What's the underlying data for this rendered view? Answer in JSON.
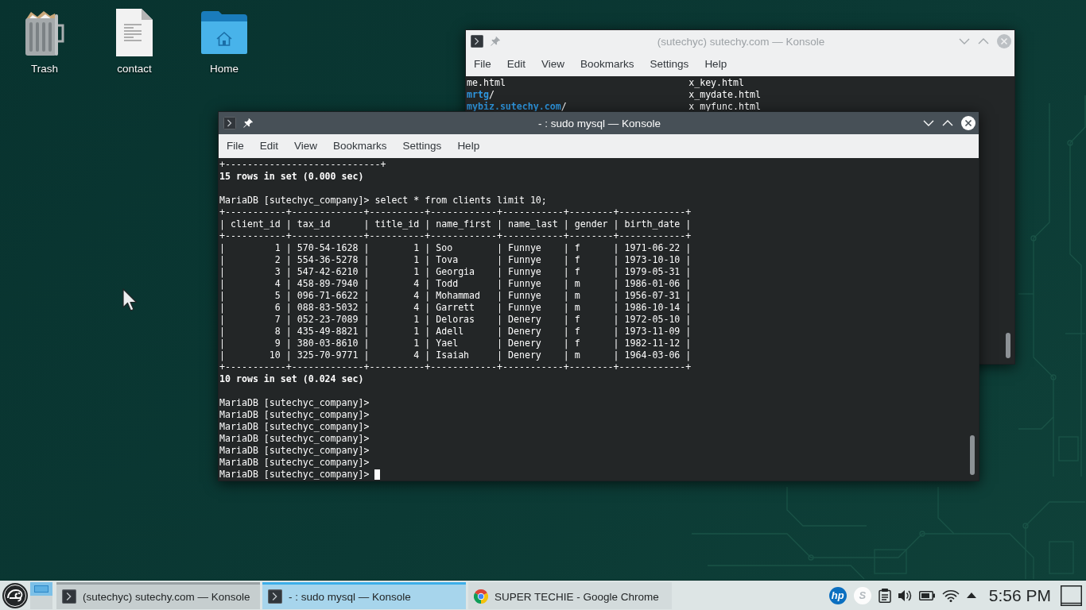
{
  "desktop_icons": [
    {
      "kind": "trash",
      "label": "Trash"
    },
    {
      "kind": "document",
      "label": "contact"
    },
    {
      "kind": "home_folder",
      "label": "Home"
    }
  ],
  "windows": [
    {
      "title": "(sutechyc) sutechy.com — Konsole",
      "active": false,
      "menu": [
        "File",
        "Edit",
        "View",
        "Bookmarks",
        "Settings",
        "Help"
      ],
      "lines": [
        {
          "kind": "columns",
          "cells": [
            "me.html",
            "x_key.html"
          ]
        },
        {
          "kind": "columns",
          "cells": [
            "**mrtg**/",
            "x_mydate.html"
          ]
        },
        {
          "kind": "columns",
          "cells": [
            "**mybiz.sutechy.com**/",
            "x_myfunc.html"
          ]
        }
      ]
    },
    {
      "title": "- : sudo mysql — Konsole",
      "active": true,
      "cursor": true,
      "menu": [
        "File",
        "Edit",
        "View",
        "Bookmarks",
        "Settings",
        "Help"
      ],
      "lines": [
        {
          "kind": "line",
          "text": "+----------------------------+"
        },
        {
          "kind": "result",
          "text": "15 rows in set (0.000 sec)"
        },
        {
          "kind": "blank"
        },
        {
          "kind": "line",
          "text": "MariaDB [sutechyc_company]> select * from clients limit 10;"
        },
        {
          "kind": "line",
          "text": "+-----------+-------------+----------+------------+-----------+--------+------------+"
        },
        {
          "kind": "line",
          "text": "| client_id | tax_id      | title_id | name_first | name_last | gender | birth_date |"
        },
        {
          "kind": "line",
          "text": "+-----------+-------------+----------+------------+-----------+--------+------------+"
        },
        {
          "kind": "line",
          "text": "|         1 | 570-54-1628 |        1 | Soo        | Funnye    | f      | 1971-06-22 |"
        },
        {
          "kind": "line",
          "text": "|         2 | 554-36-5278 |        1 | Tova       | Funnye    | f      | 1973-10-10 |"
        },
        {
          "kind": "line",
          "text": "|         3 | 547-42-6210 |        1 | Georgia    | Funnye    | f      | 1979-05-31 |"
        },
        {
          "kind": "line",
          "text": "|         4 | 458-89-7940 |        4 | Todd       | Funnye    | m      | 1986-01-06 |"
        },
        {
          "kind": "line",
          "text": "|         5 | 096-71-6622 |        4 | Mohammad   | Funnye    | m      | 1956-07-31 |"
        },
        {
          "kind": "line",
          "text": "|         6 | 088-83-5032 |        4 | Garrett    | Funnye    | m      | 1986-10-14 |"
        },
        {
          "kind": "line",
          "text": "|         7 | 052-23-7089 |        1 | Deloras    | Denery    | f      | 1972-05-10 |"
        },
        {
          "kind": "line",
          "text": "|         8 | 435-49-8821 |        1 | Adell      | Denery    | f      | 1973-11-09 |"
        },
        {
          "kind": "line",
          "text": "|         9 | 380-03-8610 |        1 | Yael       | Denery    | f      | 1982-11-12 |"
        },
        {
          "kind": "line",
          "text": "|        10 | 325-70-9771 |        4 | Isaiah     | Denery    | m      | 1964-03-06 |"
        },
        {
          "kind": "line",
          "text": "+-----------+-------------+----------+------------+-----------+--------+------------+"
        },
        {
          "kind": "result",
          "text": "10 rows in set (0.024 sec)"
        },
        {
          "kind": "blank"
        },
        {
          "kind": "line",
          "text": "MariaDB [sutechyc_company]>"
        },
        {
          "kind": "line",
          "text": "MariaDB [sutechyc_company]>"
        },
        {
          "kind": "line",
          "text": "MariaDB [sutechyc_company]>"
        },
        {
          "kind": "line",
          "text": "MariaDB [sutechyc_company]>"
        },
        {
          "kind": "line",
          "text": "MariaDB [sutechyc_company]>"
        },
        {
          "kind": "line",
          "text": "MariaDB [sutechyc_company]>"
        },
        {
          "kind": "line",
          "text": "MariaDB [sutechyc_company]>"
        }
      ]
    }
  ],
  "taskbar": {
    "pager": [
      {
        "selected": true
      },
      {
        "selected": false
      }
    ],
    "tasks": [
      {
        "kind": "terminal",
        "label": "(sutechyc) sutechy.com — Konsole",
        "selected": false,
        "outlined": true
      },
      {
        "kind": "terminal",
        "label": "- : sudo mysql — Konsole",
        "selected": true,
        "outlined": false
      },
      {
        "kind": "browser",
        "label": "SUPER TECHIE - Google Chrome",
        "selected": false,
        "outlined": false
      }
    ],
    "tray": [
      {
        "kind": "badge",
        "text": "hp",
        "color": "#0b6fc0"
      },
      {
        "kind": "badge",
        "text": "S",
        "color": "#fcfcfc"
      },
      {
        "kind": "clipboard"
      },
      {
        "kind": "speaker"
      },
      {
        "kind": "battery"
      },
      {
        "kind": "wifi"
      },
      {
        "kind": "expand"
      }
    ],
    "clock": "5:56 PM"
  }
}
